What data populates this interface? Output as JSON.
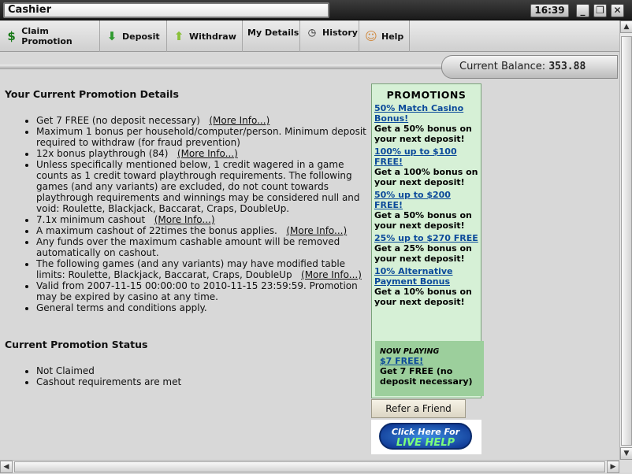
{
  "window": {
    "title": "Cashier",
    "clock": "16:39"
  },
  "toolbar": {
    "claim_promotion": "Claim Promotion",
    "deposit": "Deposit",
    "withdraw": "Withdraw",
    "my_details": "My Details",
    "history": "History",
    "help": "Help"
  },
  "balance": {
    "label": "Current Balance:",
    "value": "353.88"
  },
  "details": {
    "heading": "Your Current Promotion Details",
    "more_info": "(More Info...)",
    "items": [
      "Get 7 FREE (no deposit necessary)",
      "Maximum 1 bonus per household/computer/person. Minimum deposit required to withdraw (for fraud prevention)",
      "12x bonus playthrough (84)",
      "Unless specifically mentioned below, 1 credit wagered in a game counts as 1 credit toward playthrough requirements. The following games (and any variants) are excluded, do not count towards playthrough requirements and winnings may be considered null and void: Roulette, Blackjack, Baccarat, Craps, DoubleUp.",
      "7.1x minimum cashout",
      "A maximum cashout of 22times the bonus applies.",
      "Any funds over the maximum cashable amount will be removed automatically on cashout.",
      "The following games (and any variants) may have modified table limits: Roulette, Blackjack, Baccarat, Craps, DoubleUp",
      "Valid from 2007-11-15 00:00:00 to 2010-11-15 23:59:59. Promotion may be expired by casino at any time.",
      "General terms and conditions apply."
    ]
  },
  "status": {
    "heading": "Current Promotion Status",
    "items": [
      "Not Claimed",
      "Cashout requirements are met"
    ]
  },
  "promotions": {
    "heading": "PROMOTIONS",
    "items": [
      {
        "title": "50% Match Casino Bonus!",
        "desc": "Get a 50% bonus on your next deposit!"
      },
      {
        "title": "100% up to $100 FREE!",
        "desc": "Get a 100% bonus on your next deposit!"
      },
      {
        "title": "50% up to $200 FREE!",
        "desc": "Get a 50% bonus on your next deposit!"
      },
      {
        "title": "25% up to $270 FREE",
        "desc": "Get a 25% bonus on your next deposit!"
      },
      {
        "title": "10% Alternative Payment Bonus",
        "desc": "Get a 10% bonus on your next deposit!"
      }
    ],
    "now_playing": {
      "tag": "NOW PLAYING",
      "title": "$7 FREE!",
      "desc": "Get 7 FREE (no deposit necessary)"
    }
  },
  "refer_friend": "Refer a Friend",
  "live_help": {
    "line1": "Click Here For",
    "line2": "LIVE HELP"
  },
  "colors": {
    "promo_bg": "#d6f0d6",
    "now_playing_bg": "#9ccf9c",
    "link": "#0b4a9a"
  }
}
